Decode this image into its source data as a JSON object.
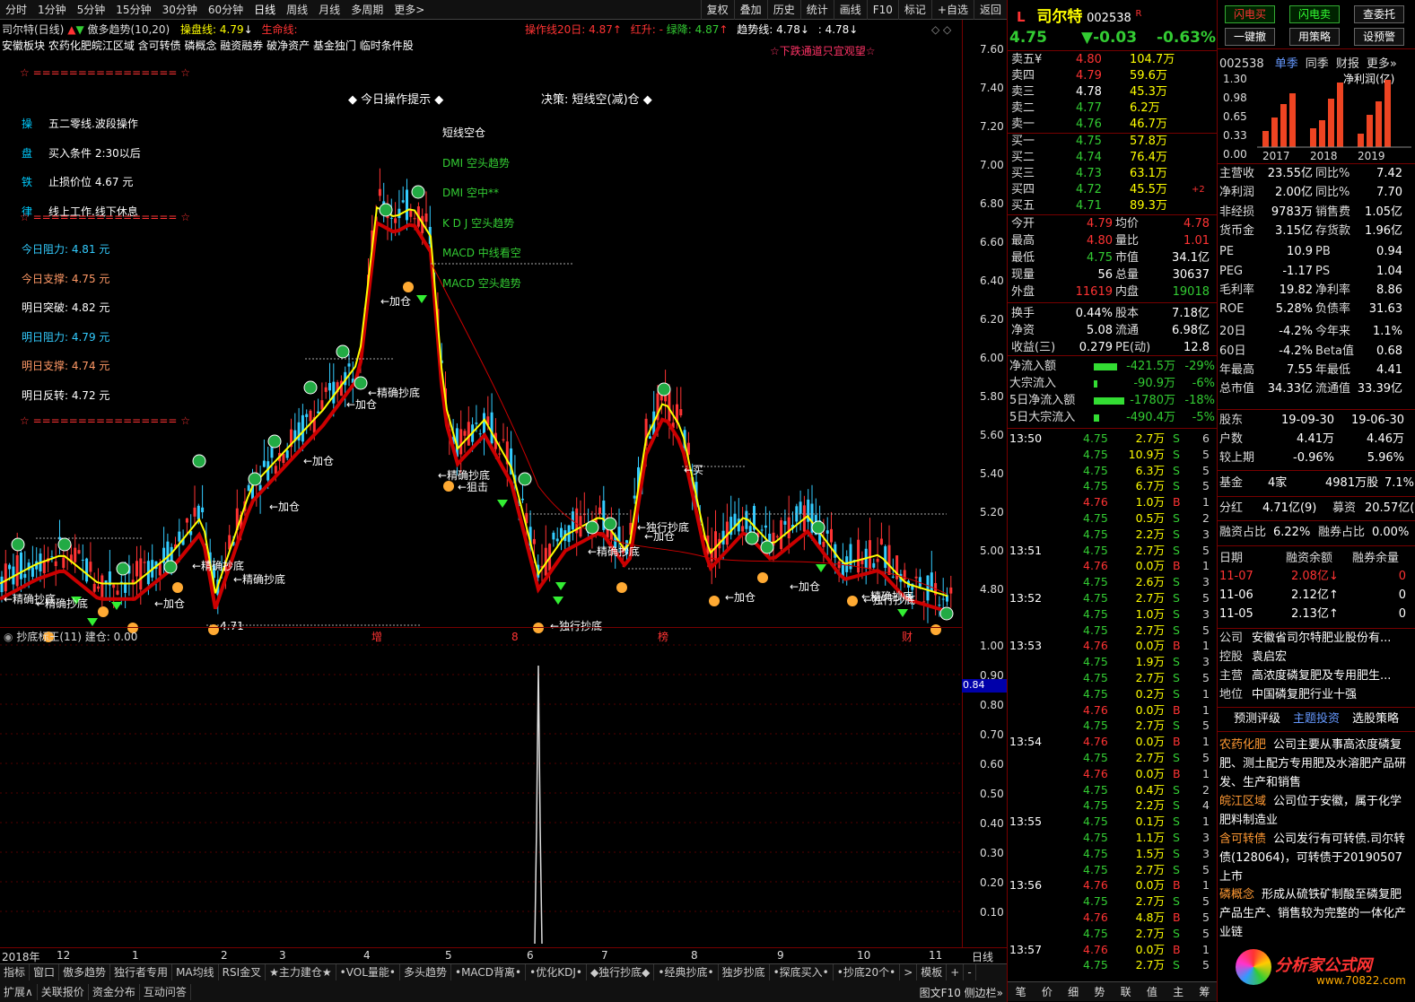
{
  "toolbar": {
    "periods": [
      "分时",
      "1分钟",
      "5分钟",
      "15分钟",
      "30分钟",
      "60分钟",
      "日线",
      "周线",
      "月线",
      "多周期",
      "更多>"
    ],
    "actions": [
      "复权",
      "叠加",
      "历史",
      "统计",
      "画线",
      "F10",
      "标记",
      "+自选",
      "返回"
    ]
  },
  "chart_header": {
    "title": "司尔特(日线)",
    "indicator": "傲多趋势(10,20)",
    "caopan": "操盘线: 4.79",
    "shengming": "生命线:",
    "caozuo20": "操作线20日: 4.87",
    "hongsheng": "红升: -",
    "lvjiang": "绿降: 4.87",
    "qushi": "趋势线: 4.78",
    "qushi2": ": 4.78"
  },
  "tags_line": "安徽板块 农药化肥皖江区域 含可转债 磷概念 融资融券 破净资产 基金独门 临时条件股",
  "down_warning": "☆下跌通道只宜观望☆",
  "left_panel": {
    "stars": "☆ ================ ☆",
    "items": [
      {
        "k": "操",
        "v": "五二零线.波段操作"
      },
      {
        "k": "盘",
        "v": "买入条件 2:30以后"
      },
      {
        "k": "铁",
        "v": "止损价位 4.67 元"
      },
      {
        "k": "律",
        "v": "线上工作.线下休息"
      }
    ],
    "levels": [
      {
        "t": "今日阻力: 4.81 元",
        "c": "#33ccff"
      },
      {
        "t": "今日支撑: 4.75 元",
        "c": "#ff9966"
      },
      {
        "t": "明日突破: 4.82 元",
        "c": "#ffffff"
      },
      {
        "t": "明日阻力: 4.79 元",
        "c": "#33ccff"
      },
      {
        "t": "明日支撑: 4.74 元",
        "c": "#ff9966"
      },
      {
        "t": "明日反转: 4.72 元",
        "c": "#ffffff"
      }
    ]
  },
  "tips": {
    "head": "◆ 今日操作提示 ◆",
    "decision": "决策: 短线空(减)仓 ◆",
    "list": [
      "短线空仓",
      "DMI 空头趋势",
      "DMI 空中**",
      "K D J 空头趋势",
      "MACD 中线看空",
      "MACD 空头趋势"
    ]
  },
  "price_axis": [
    "7.60",
    "7.40",
    "7.20",
    "7.00",
    "6.80",
    "6.60",
    "6.40",
    "6.20",
    "6.00",
    "5.80",
    "5.60",
    "5.40",
    "5.20",
    "5.00",
    "4.80"
  ],
  "lower_panel": {
    "title": "抄底标王(11)",
    "jiancang": "建仓: 0.00",
    "axis": [
      "1.00",
      "0.90",
      "0.80",
      "0.70",
      "0.60",
      "0.50",
      "0.40",
      "0.30",
      "0.20",
      "0.10"
    ],
    "marker": "0.84"
  },
  "time_axis": [
    "2018年",
    "12",
    "1",
    "2",
    "3",
    "4",
    "5",
    "6",
    "7",
    "8",
    "9",
    "10",
    "11"
  ],
  "time_axis_right": "日线",
  "chart_annotations": [
    "精确抄底",
    "加仓",
    "精确抄底",
    "加仓",
    "精确抄底",
    "加仓",
    "加仓",
    "加仓",
    "精确抄底",
    "精确抄底",
    "狙击",
    "精确抄底",
    "独行抄底",
    "加仓",
    "买",
    "加仓",
    "加仓",
    "独行抄底",
    "精确抄底",
    "独行抄底",
    "精确抄底",
    "4.71",
    "增",
    "8",
    "榜",
    "财"
  ],
  "bottom_tabs1": [
    "指标",
    "窗口",
    "傲多趋势",
    "独行者专用",
    "MA均线",
    "RSI金叉",
    "★主力建仓★",
    "•VOL量能•",
    "多头趋势",
    "•MACD背离•",
    "•优化KDJ•",
    "◆独行抄底◆",
    "•经典抄底•",
    "独步抄底",
    "•探底买入•",
    "•抄底20个•",
    ">",
    "模板",
    "+",
    "-"
  ],
  "bottom_tabs2": [
    "扩展∧",
    "关联报价",
    "资金分布",
    "互动问答"
  ],
  "bottom_right": "图文F10  侧边栏»",
  "quote": {
    "name": "司尔特",
    "code": "002538",
    "flag": "R",
    "price": "4.75",
    "change": "▼-0.03",
    "pct": "-0.63%",
    "asks": [
      {
        "l": "卖五",
        "p": "4.80",
        "v": "104.7万"
      },
      {
        "l": "卖四",
        "p": "4.79",
        "v": "59.6万"
      },
      {
        "l": "卖三",
        "p": "4.78",
        "v": "45.3万"
      },
      {
        "l": "卖二",
        "p": "4.77",
        "v": "6.2万"
      },
      {
        "l": "卖一",
        "p": "4.76",
        "v": "46.7万"
      }
    ],
    "bids": [
      {
        "l": "买一",
        "p": "4.75",
        "v": "57.8万"
      },
      {
        "l": "买二",
        "p": "4.74",
        "v": "76.4万"
      },
      {
        "l": "买三",
        "p": "4.73",
        "v": "63.1万"
      },
      {
        "l": "买四",
        "p": "4.72",
        "v": "45.5万",
        "x": "+2"
      },
      {
        "l": "买五",
        "p": "4.71",
        "v": "89.3万"
      }
    ],
    "stats": [
      [
        "今开",
        "4.79",
        "均价",
        "4.78"
      ],
      [
        "最高",
        "4.80",
        "量比",
        "1.01"
      ],
      [
        "最低",
        "4.75",
        "市值",
        "34.1亿"
      ],
      [
        "现量",
        "56",
        "总量",
        "30637"
      ],
      [
        "外盘",
        "11619",
        "内盘",
        "19018"
      ],
      [
        "换手",
        "0.44%",
        "股本",
        "7.18亿"
      ],
      [
        "净资",
        "5.08",
        "流通",
        "6.98亿"
      ],
      [
        "收益(三)",
        "0.279",
        "PE(动)",
        "12.8"
      ]
    ],
    "flows": [
      [
        "净流入额",
        "-421.5万",
        "-29%",
        26
      ],
      [
        "大宗流入",
        "-90.9万",
        "-6%",
        4
      ],
      [
        "5日净流入额",
        "-1780万",
        "-18%",
        34
      ],
      [
        "5日大宗流入",
        "-490.4万",
        "-5%",
        6
      ]
    ],
    "ticks": [
      [
        "13:50",
        "4.75",
        "2.7万",
        "S",
        "6"
      ],
      [
        "",
        "4.75",
        "10.9万",
        "S",
        "5"
      ],
      [
        "",
        "4.75",
        "6.3万",
        "S",
        "5"
      ],
      [
        "",
        "4.75",
        "6.7万",
        "S",
        "5"
      ],
      [
        "",
        "4.76",
        "1.0万",
        "B",
        "1"
      ],
      [
        "",
        "4.75",
        "0.5万",
        "S",
        "2"
      ],
      [
        "",
        "4.75",
        "2.2万",
        "S",
        "3"
      ],
      [
        "13:51",
        "4.75",
        "2.7万",
        "S",
        "5"
      ],
      [
        "",
        "4.76",
        "0.0万",
        "B",
        "1"
      ],
      [
        "",
        "4.75",
        "2.6万",
        "S",
        "3"
      ],
      [
        "13:52",
        "4.75",
        "2.7万",
        "S",
        "5"
      ],
      [
        "",
        "4.75",
        "1.0万",
        "S",
        "3"
      ],
      [
        "",
        "4.75",
        "2.7万",
        "S",
        "5"
      ],
      [
        "13:53",
        "4.76",
        "0.0万",
        "B",
        "1"
      ],
      [
        "",
        "4.75",
        "1.9万",
        "S",
        "3"
      ],
      [
        "",
        "4.75",
        "2.7万",
        "S",
        "5"
      ],
      [
        "",
        "4.75",
        "0.2万",
        "S",
        "1"
      ],
      [
        "",
        "4.76",
        "0.0万",
        "B",
        "1"
      ],
      [
        "",
        "4.75",
        "2.7万",
        "S",
        "5"
      ],
      [
        "13:54",
        "4.76",
        "0.0万",
        "B",
        "1"
      ],
      [
        "",
        "4.75",
        "2.7万",
        "S",
        "5"
      ],
      [
        "",
        "4.76",
        "0.0万",
        "B",
        "1"
      ],
      [
        "",
        "4.75",
        "0.4万",
        "S",
        "2"
      ],
      [
        "",
        "4.75",
        "2.2万",
        "S",
        "4"
      ],
      [
        "13:55",
        "4.75",
        "0.1万",
        "S",
        "1"
      ],
      [
        "",
        "4.75",
        "1.1万",
        "S",
        "3"
      ],
      [
        "",
        "4.75",
        "1.5万",
        "S",
        "3"
      ],
      [
        "",
        "4.75",
        "2.7万",
        "S",
        "5"
      ],
      [
        "13:56",
        "4.76",
        "0.0万",
        "B",
        "1"
      ],
      [
        "",
        "4.75",
        "2.7万",
        "S",
        "5"
      ],
      [
        "",
        "4.76",
        "4.8万",
        "B",
        "5"
      ],
      [
        "",
        "4.75",
        "2.7万",
        "S",
        "5"
      ],
      [
        "13:57",
        "4.76",
        "0.0万",
        "B",
        "1"
      ],
      [
        "",
        "4.75",
        "2.7万",
        "S",
        "5"
      ]
    ]
  },
  "side": {
    "buttons": [
      "闪电买",
      "闪电卖",
      "查委托",
      "一键撤",
      "用策略",
      "设预警"
    ],
    "code": "002538",
    "tabs": [
      "单季",
      "同季",
      "财报",
      "更多»"
    ],
    "chart_label": "净利润(亿)",
    "y_ticks": [
      "1.30",
      "0.98",
      "0.65",
      "0.33",
      "0.00"
    ],
    "years": [
      "2017",
      "2018",
      "2019"
    ],
    "bars": [
      0.3,
      0.55,
      0.8,
      1.0,
      0.35,
      0.5,
      0.9,
      1.2,
      0.25,
      0.6,
      0.85,
      1.25
    ],
    "fin": [
      [
        "主营收",
        "23.55亿",
        "同比%",
        "7.42"
      ],
      [
        "净利润",
        "2.00亿",
        "同比%",
        "7.70"
      ],
      [
        "非经损",
        "9783万",
        "销售费",
        "1.05亿"
      ],
      [
        "货币金",
        "3.15亿",
        "存货款",
        "1.96亿"
      ],
      [
        "PE",
        "10.9",
        "PB",
        "0.94"
      ],
      [
        "PEG",
        "-1.17",
        "PS",
        "1.04"
      ],
      [
        "毛利率",
        "19.82",
        "净利率",
        "8.86"
      ],
      [
        "ROE",
        "5.28%",
        "负债率",
        "31.63"
      ],
      [
        "20日",
        "-4.2%",
        "今年来",
        "1.1%"
      ],
      [
        "60日",
        "-4.2%",
        "Beta值",
        "0.68"
      ],
      [
        "年最高",
        "7.55",
        "年最低",
        "4.41"
      ],
      [
        "总市值",
        "34.33亿",
        "流通值",
        "33.39亿"
      ]
    ],
    "holders": [
      [
        "股东",
        "19-09-30",
        "19-06-30"
      ],
      [
        "户数",
        "4.41万",
        "4.46万"
      ],
      [
        "较上期",
        "-0.96%",
        "5.96%"
      ]
    ],
    "fund": [
      "基金",
      "4家",
      "4981万股",
      "7.1%"
    ],
    "fenhong": [
      "分红",
      "4.71亿(9)",
      "募资",
      "20.57亿(2)"
    ],
    "rz": [
      "融资占比",
      "6.22%",
      "融券占比",
      "0.00%"
    ],
    "rz_table_head": [
      "日期",
      "融资余额",
      "融券余量"
    ],
    "rz_table": [
      [
        "11-07",
        "2.08亿↓",
        "0"
      ],
      [
        "11-06",
        "2.12亿↑",
        "0"
      ],
      [
        "11-05",
        "2.13亿↑",
        "0"
      ]
    ],
    "company": [
      [
        "公司",
        "安徽省司尔特肥业股份有..."
      ],
      [
        "控股",
        "袁启宏"
      ],
      [
        "主营",
        "高浓度磷复肥及专用肥生..."
      ],
      [
        "地位",
        "中国磷复肥行业十强"
      ]
    ],
    "sub_tabs": [
      "预测评级",
      "主题投资",
      "选股策略"
    ],
    "themes": [
      [
        "农药化肥",
        "公司主要从事高浓度磷复肥、测土配方专用肥及水溶肥产品研发、生产和销售"
      ],
      [
        "皖江区域",
        "公司位于安徽，属于化学肥料制造业"
      ],
      [
        "含可转债",
        "公司发行有可转债.司尔转债(128064)，可转债于20190507上市"
      ],
      [
        "磷概念",
        "形成从硫铁矿制酸至磷复肥产品生产、销售较为完整的一体化产业链"
      ]
    ],
    "watermark": "分析家公式网",
    "watermark_url": "www.70822.com"
  },
  "bottom_right_tabs": [
    "笔",
    "价",
    "细",
    "势",
    "联",
    "值",
    "主",
    "筹"
  ]
}
